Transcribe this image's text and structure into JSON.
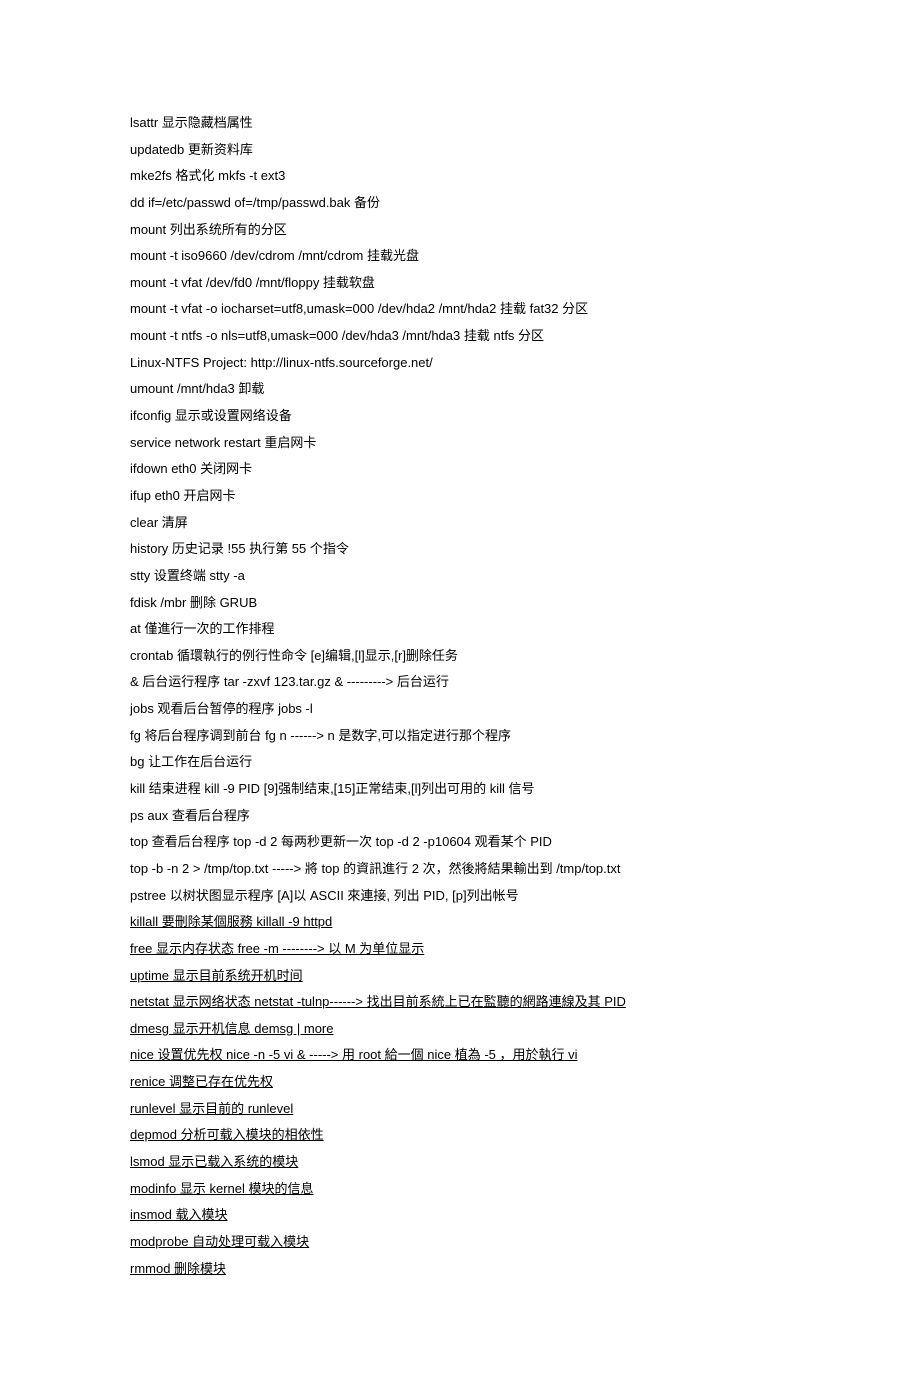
{
  "lines": [
    {
      "text": "lsattr 显示隐藏档属性",
      "underline": false
    },
    {
      "text": "updatedb 更新资料库",
      "underline": false
    },
    {
      "text": "mke2fs 格式化 mkfs -t ext3",
      "underline": false
    },
    {
      "text": "dd if=/etc/passwd of=/tmp/passwd.bak 备份",
      "underline": false
    },
    {
      "text": "mount 列出系统所有的分区",
      "underline": false
    },
    {
      "text": "mount -t iso9660 /dev/cdrom /mnt/cdrom 挂载光盘",
      "underline": false
    },
    {
      "text": "mount -t vfat /dev/fd0 /mnt/floppy 挂载软盘",
      "underline": false
    },
    {
      "text": "mount -t vfat -o iocharset=utf8,umask=000 /dev/hda2 /mnt/hda2 挂载 fat32 分区",
      "underline": false
    },
    {
      "text": "mount -t ntfs -o nls=utf8,umask=000 /dev/hda3 /mnt/hda3 挂载 ntfs 分区",
      "underline": false
    },
    {
      "text": "Linux-NTFS Project: http://linux-ntfs.sourceforge.net/",
      "underline": false
    },
    {
      "text": "umount /mnt/hda3 卸载",
      "underline": false
    },
    {
      "text": "ifconfig 显示或设置网络设备",
      "underline": false
    },
    {
      "text": "service network restart 重启网卡",
      "underline": false
    },
    {
      "text": "ifdown eth0 关闭网卡",
      "underline": false
    },
    {
      "text": "ifup eth0 开启网卡",
      "underline": false
    },
    {
      "text": "clear 清屏",
      "underline": false
    },
    {
      "text": "history 历史记录 !55 执行第 55 个指令",
      "underline": false
    },
    {
      "text": "stty 设置终端 stty -a",
      "underline": false
    },
    {
      "text": "fdisk /mbr 删除 GRUB",
      "underline": false
    },
    {
      "text": "at 僅進行一次的工作排程",
      "underline": false
    },
    {
      "text": "crontab 循環執行的例行性命令 [e]编辑,[l]显示,[r]删除任务",
      "underline": false
    },
    {
      "text": "& 后台运行程序 tar -zxvf 123.tar.gz & ---------> 后台运行",
      "underline": false
    },
    {
      "text": "jobs 观看后台暂停的程序 jobs -l",
      "underline": false
    },
    {
      "text": "fg 将后台程序调到前台 fg n ------> n 是数字,可以指定进行那个程序",
      "underline": false
    },
    {
      "text": "bg 让工作在后台运行",
      "underline": false
    },
    {
      "text": "kill 结束进程 kill -9 PID [9]强制结束,[15]正常结束,[l]列出可用的 kill 信号",
      "underline": false
    },
    {
      "text": "ps aux 查看后台程序",
      "underline": false
    },
    {
      "text": "top 查看后台程序 top -d 2 每两秒更新一次 top -d 2 -p10604 观看某个 PID",
      "underline": false
    },
    {
      "text": "top -b -n 2 > /tmp/top.txt -----> 將 top 的資訊進行 2 次，然後將結果輸出到 /tmp/top.txt",
      "underline": false
    },
    {
      "text": "pstree 以树状图显示程序 [A]以 ASCII 來連接, 列出 PID, [p]列出帐号 ",
      "underline": false
    },
    {
      "text": "killall 要刪除某個服務 killall -9 httpd ",
      "underline": true
    },
    {
      "text": "free 显示内存状态 free -m --------> 以 M 为单位显示 ",
      "underline": true
    },
    {
      "text": "uptime 显示目前系统开机时间 ",
      "underline": true
    },
    {
      "text": "netstat 显示网络状态 netstat -tulnp------> 找出目前系統上已在監聽的網路連線及其 PID ",
      "underline": true
    },
    {
      "text": "dmesg 显示开机信息 demsg | more ",
      "underline": true
    },
    {
      "text": "nice 设置优先权 nice -n -5 vi & -----> 用 root 給一個 nice 植為 -5 ，用於執行 vi ",
      "underline": true
    },
    {
      "text": "renice 调整已存在优先权 ",
      "underline": true
    },
    {
      "text": "runlevel 显示目前的 runlevel ",
      "underline": true
    },
    {
      "text": "depmod 分析可载入模块的相依性 ",
      "underline": true
    },
    {
      "text": "lsmod 显示已载入系统的模块 ",
      "underline": true
    },
    {
      "text": "modinfo 显示 kernel 模块的信息 ",
      "underline": true
    },
    {
      "text": "insmod 载入模块 ",
      "underline": true
    },
    {
      "text": "modprobe 自动处理可载入模块 ",
      "underline": true
    },
    {
      "text": "rmmod 删除模块 ",
      "underline": true
    }
  ]
}
